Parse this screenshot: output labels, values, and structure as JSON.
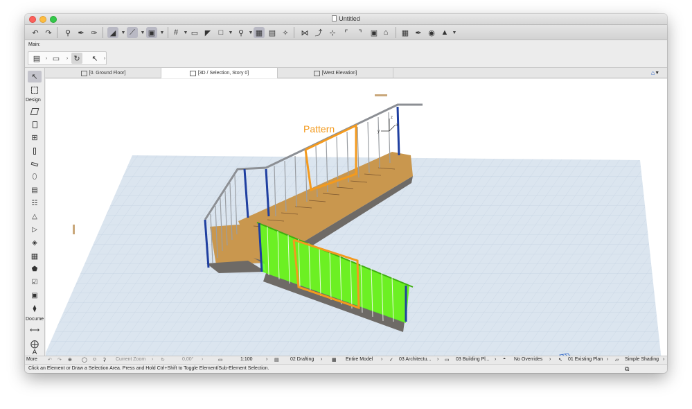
{
  "window": {
    "title": "Untitled"
  },
  "infobox": {
    "label": "Main:"
  },
  "tabs": [
    {
      "label": "[0. Ground Floor]"
    },
    {
      "label": "[3D / Selection, Story 0]"
    },
    {
      "label": "[West Elevation]"
    }
  ],
  "toolbox": {
    "design_label": "Design",
    "document_label": "Docume",
    "more_label": "More"
  },
  "annotation": {
    "label": "Pattern",
    "color": "#f39a1e"
  },
  "axes": {
    "x": "x",
    "y": "y",
    "z": "z"
  },
  "status": {
    "zoom_label": "Current Zoom",
    "angle": "0,00°",
    "scale": "1:100",
    "layer_combo": "02 Drafting",
    "model_view": "Entire Model",
    "pen_set": "03 Architectu...",
    "dimension": "03 Building Pl...",
    "overrides": "No Overrides",
    "renovation": "01 Existing Plan",
    "shading": "Simple Shading"
  },
  "hint": "Click an Element or Draw a Selection Area. Press and Hold Ctrl+Shift to Toggle Element/Sub-Element Selection.",
  "colors": {
    "grid_floor": "#dbe5ef",
    "grid_line": "#bfcfe0",
    "wood": "#c9974e",
    "stair_side": "#6e6a66",
    "rail": "#8c8f94",
    "post": "#1f3fa0",
    "selected": "#5cff1c",
    "highlight": "#f39a1e"
  }
}
